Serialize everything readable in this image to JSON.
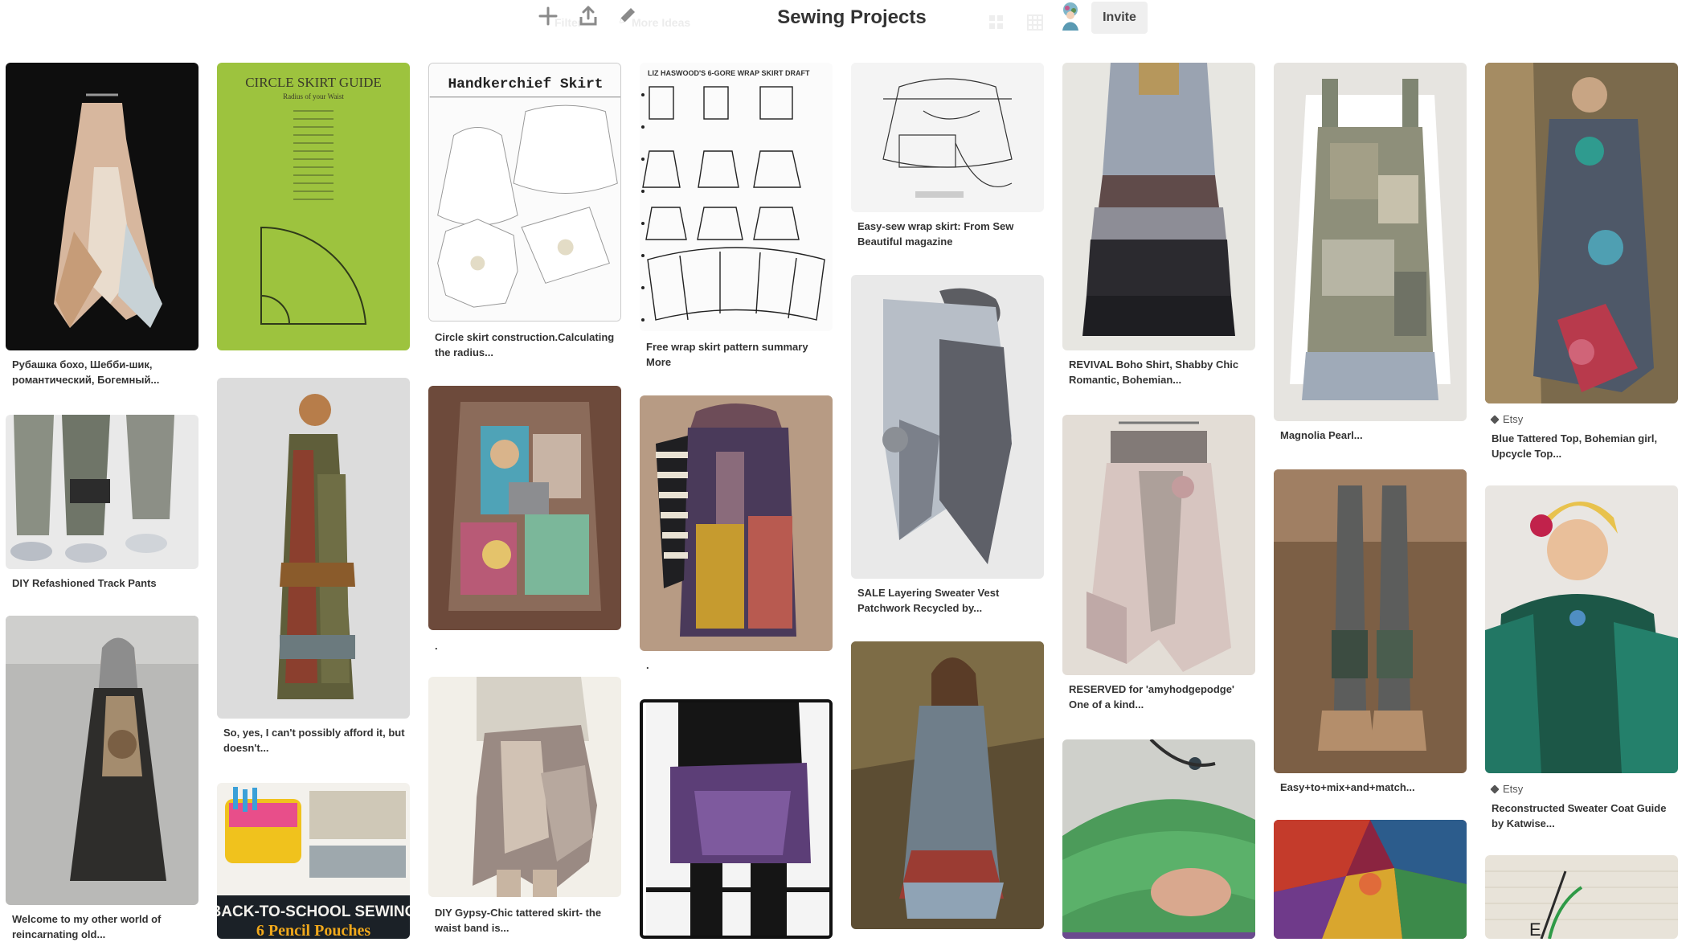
{
  "header": {
    "board_title": "Sewing Projects",
    "invite_label": "Invite",
    "ghost_left": "Filter",
    "ghost_more": "More Ideas",
    "icons": [
      "plus-icon",
      "share-icon",
      "pencil-icon",
      "grid-icon",
      "grid-icon",
      "avatar"
    ]
  },
  "pins": [
    {
      "desc": "Рубашка бохо, Шебби-шик, романтический, Богемный..."
    },
    {
      "desc": "DIY Refashioned Track Pants"
    },
    {
      "desc": "Welcome to my other world of reincarnating old..."
    },
    {
      "desc": ""
    },
    {
      "desc": "So, yes, I can't possibly afford it, but doesn't..."
    },
    {
      "desc": ""
    },
    {
      "desc": "Circle skirt construction.Calculating the radius..."
    },
    {
      "desc": "."
    },
    {
      "desc": "DIY Gypsy-Chic tattered skirt- the waist band is..."
    },
    {
      "desc": "Free wrap skirt pattern summary More"
    },
    {
      "desc": "."
    },
    {
      "desc": ""
    },
    {
      "desc": "Easy-sew wrap skirt: From Sew Beautiful magazine"
    },
    {
      "desc": "SALE Layering Sweater Vest Patchwork Recycled by..."
    },
    {
      "desc": ""
    },
    {
      "desc": "REVIVAL Boho Shirt, Shabby Chic Romantic, Bohemian..."
    },
    {
      "desc": "RESERVED for 'amyhodgepodge' One of a kind..."
    },
    {
      "desc": ""
    },
    {
      "desc": "Magnolia Pearl..."
    },
    {
      "desc": "Easy+to+mix+and+match..."
    },
    {
      "desc": ""
    },
    {
      "desc": "Blue Tattered Top, Bohemian girl, Upcycle Top...",
      "source": "Etsy"
    },
    {
      "desc": "Reconstructed Sweater Coat Guide by Katwise...",
      "source": "Etsy"
    },
    {
      "desc": ""
    }
  ],
  "image_text": {
    "circle_skirt": "CIRCLE SKIRT GUIDE",
    "circle_sub": "Radius of your Waist",
    "hanky": "Handkerchief Skirt",
    "wrap_draft": "LIZ HASWOOD'S 6-GORE WRAP SKIRT DRAFT",
    "school": "BACK-TO-SCHOOL SEWING",
    "pouches": "6 Pencil Pouches"
  }
}
